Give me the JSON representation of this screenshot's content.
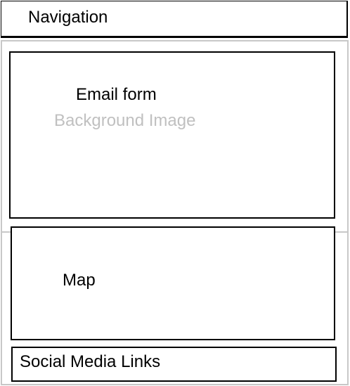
{
  "navigation": {
    "label": "Navigation"
  },
  "hero": {
    "form_label": "Email form",
    "background_label": "Background Image"
  },
  "map": {
    "label": "Map"
  },
  "footer": {
    "label": "Social Media Links"
  },
  "colors": {
    "outline": "#000000",
    "background_region_outline": "#c8c8c8",
    "placeholder_text": "#c0c0c0"
  }
}
